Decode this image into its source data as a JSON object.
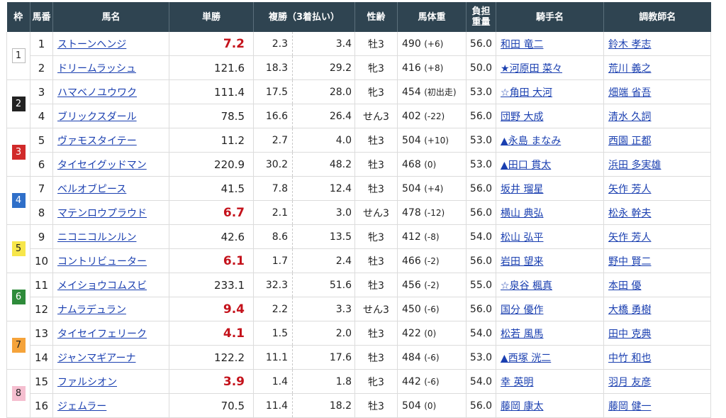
{
  "headers": {
    "waku": "枠",
    "umaban": "馬番",
    "name": "馬名",
    "win": "単勝",
    "place": "複勝（3着払い）",
    "sex_age": "性齢",
    "weight": "馬体重",
    "burden_1": "負担",
    "burden_2": "重量",
    "jockey": "騎手名",
    "trainer": "調教師名"
  },
  "colors": {
    "header_bg": "#2f4451",
    "favorite_odds": "#c4121b",
    "link": "#1a3fb0",
    "waku": [
      "#ffffff",
      "#222222",
      "#d12a2a",
      "#2f6fc9",
      "#f7e64a",
      "#2e8b3a",
      "#f5a33a",
      "#f5bfd0"
    ],
    "waku_text": [
      "#222222",
      "#ffffff",
      "#ffffff",
      "#ffffff",
      "#222222",
      "#ffffff",
      "#222222",
      "#222222"
    ]
  },
  "waku": [
    {
      "n": "1",
      "rows": 2
    },
    {
      "n": "2",
      "rows": 2
    },
    {
      "n": "3",
      "rows": 2
    },
    {
      "n": "4",
      "rows": 2
    },
    {
      "n": "5",
      "rows": 2
    },
    {
      "n": "6",
      "rows": 2
    },
    {
      "n": "7",
      "rows": 2
    },
    {
      "n": "8",
      "rows": 2
    }
  ],
  "horses": [
    {
      "num": "1",
      "name": "ストーンヘンジ",
      "win": "7.2",
      "fav": true,
      "pl_lo": "2.3",
      "pl_hi": "3.4",
      "sex": "牡3",
      "w": "490",
      "wd": "(+6)",
      "kin": "56.0",
      "jockey": "和田 竜二",
      "trainer": "鈴木 孝志"
    },
    {
      "num": "2",
      "name": "ドリームラッシュ",
      "win": "121.6",
      "fav": false,
      "pl_lo": "18.3",
      "pl_hi": "29.2",
      "sex": "牝3",
      "w": "416",
      "wd": "(+8)",
      "kin": "50.0",
      "jockey": "★河原田 菜々",
      "trainer": "荒川 義之"
    },
    {
      "num": "3",
      "name": "ハマベノユウワク",
      "win": "111.4",
      "fav": false,
      "pl_lo": "17.5",
      "pl_hi": "28.0",
      "sex": "牝3",
      "w": "454",
      "wd": "(初出走)",
      "kin": "53.0",
      "jockey": "☆角田 大河",
      "trainer": "畑端 省吾"
    },
    {
      "num": "4",
      "name": "ブリックスダール",
      "win": "78.5",
      "fav": false,
      "pl_lo": "16.6",
      "pl_hi": "26.4",
      "sex": "せん3",
      "w": "402",
      "wd": "(-22)",
      "kin": "56.0",
      "jockey": "団野 大成",
      "trainer": "清水 久詞"
    },
    {
      "num": "5",
      "name": "ヴァモスタイテー",
      "win": "11.2",
      "fav": false,
      "pl_lo": "2.7",
      "pl_hi": "4.0",
      "sex": "牡3",
      "w": "504",
      "wd": "(+10)",
      "kin": "53.0",
      "jockey": "▲永島 まなみ",
      "trainer": "西園 正都"
    },
    {
      "num": "6",
      "name": "タイセイグッドマン",
      "win": "220.9",
      "fav": false,
      "pl_lo": "30.2",
      "pl_hi": "48.2",
      "sex": "牡3",
      "w": "468",
      "wd": "(0)",
      "kin": "53.0",
      "jockey": "▲田口 貫太",
      "trainer": "浜田 多実雄"
    },
    {
      "num": "7",
      "name": "ベルオブピース",
      "win": "41.5",
      "fav": false,
      "pl_lo": "7.8",
      "pl_hi": "12.4",
      "sex": "牡3",
      "w": "504",
      "wd": "(+4)",
      "kin": "56.0",
      "jockey": "坂井 瑠星",
      "trainer": "矢作 芳人"
    },
    {
      "num": "8",
      "name": "マテンロウプラウド",
      "win": "6.7",
      "fav": true,
      "pl_lo": "2.1",
      "pl_hi": "3.0",
      "sex": "せん3",
      "w": "478",
      "wd": "(-12)",
      "kin": "56.0",
      "jockey": "横山 典弘",
      "trainer": "松永 幹夫"
    },
    {
      "num": "9",
      "name": "ニコニコルンルン",
      "win": "42.6",
      "fav": false,
      "pl_lo": "8.6",
      "pl_hi": "13.5",
      "sex": "牝3",
      "w": "412",
      "wd": "(-8)",
      "kin": "54.0",
      "jockey": "松山 弘平",
      "trainer": "矢作 芳人"
    },
    {
      "num": "10",
      "name": "コントリビューター",
      "win": "6.1",
      "fav": true,
      "pl_lo": "1.7",
      "pl_hi": "2.4",
      "sex": "牡3",
      "w": "466",
      "wd": "(-2)",
      "kin": "56.0",
      "jockey": "岩田 望来",
      "trainer": "野中 賢二"
    },
    {
      "num": "11",
      "name": "メイショウコムスビ",
      "win": "233.1",
      "fav": false,
      "pl_lo": "32.3",
      "pl_hi": "51.6",
      "sex": "牡3",
      "w": "456",
      "wd": "(-2)",
      "kin": "55.0",
      "jockey": "☆泉谷 楓真",
      "trainer": "本田 優"
    },
    {
      "num": "12",
      "name": "ナムラデュラン",
      "win": "9.4",
      "fav": true,
      "pl_lo": "2.2",
      "pl_hi": "3.3",
      "sex": "せん3",
      "w": "450",
      "wd": "(-6)",
      "kin": "56.0",
      "jockey": "国分 優作",
      "trainer": "大橋 勇樹"
    },
    {
      "num": "13",
      "name": "タイセイフェリーク",
      "win": "4.1",
      "fav": true,
      "pl_lo": "1.5",
      "pl_hi": "2.0",
      "sex": "牡3",
      "w": "422",
      "wd": "(0)",
      "kin": "54.0",
      "jockey": "松若 風馬",
      "trainer": "田中 克典"
    },
    {
      "num": "14",
      "name": "ジャンマギアーナ",
      "win": "122.2",
      "fav": false,
      "pl_lo": "11.1",
      "pl_hi": "17.6",
      "sex": "牡3",
      "w": "484",
      "wd": "(-6)",
      "kin": "53.0",
      "jockey": "▲西塚 洸二",
      "trainer": "中竹 和也"
    },
    {
      "num": "15",
      "name": "ファルシオン",
      "win": "3.9",
      "fav": true,
      "pl_lo": "1.4",
      "pl_hi": "1.8",
      "sex": "牝3",
      "w": "442",
      "wd": "(-6)",
      "kin": "54.0",
      "jockey": "幸 英明",
      "trainer": "羽月 友彦"
    },
    {
      "num": "16",
      "name": "ジェムラー",
      "win": "70.5",
      "fav": false,
      "pl_lo": "11.4",
      "pl_hi": "18.2",
      "sex": "牡3",
      "w": "504",
      "wd": "(0)",
      "kin": "56.0",
      "jockey": "藤岡 康太",
      "trainer": "藤岡 健一"
    }
  ]
}
